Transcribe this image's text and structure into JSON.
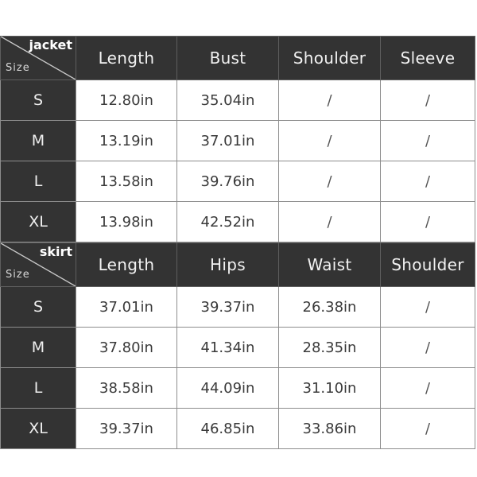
{
  "tables": [
    {
      "category_label": "jacket",
      "size_label": "Size",
      "columns": [
        "Length",
        "Bust",
        "Shoulder",
        "Sleeve"
      ],
      "rows": [
        {
          "size": "S",
          "values": [
            "12.80in",
            "35.04in",
            "/",
            "/"
          ]
        },
        {
          "size": "M",
          "values": [
            "13.19in",
            "37.01in",
            "/",
            "/"
          ]
        },
        {
          "size": "L",
          "values": [
            "13.58in",
            "39.76in",
            "/",
            "/"
          ]
        },
        {
          "size": "XL",
          "values": [
            "13.98in",
            "42.52in",
            "/",
            "/"
          ]
        }
      ]
    },
    {
      "category_label": "skirt",
      "size_label": "Size",
      "columns": [
        "Length",
        "Hips",
        "Waist",
        "Shoulder"
      ],
      "rows": [
        {
          "size": "S",
          "values": [
            "37.01in",
            "39.37in",
            "26.38in",
            "/"
          ]
        },
        {
          "size": "M",
          "values": [
            "37.80in",
            "41.34in",
            "28.35in",
            "/"
          ]
        },
        {
          "size": "L",
          "values": [
            "38.58in",
            "44.09in",
            "31.10in",
            "/"
          ]
        },
        {
          "size": "XL",
          "values": [
            "39.37in",
            "46.85in",
            "33.86in",
            "/"
          ]
        }
      ]
    }
  ],
  "colors": {
    "header_background": "#333333",
    "header_text": "#f2f2f2",
    "cell_background": "#ffffff",
    "cell_text": "#3a3a3a",
    "border": "#8d8d8d",
    "page_background": "#ffffff"
  }
}
